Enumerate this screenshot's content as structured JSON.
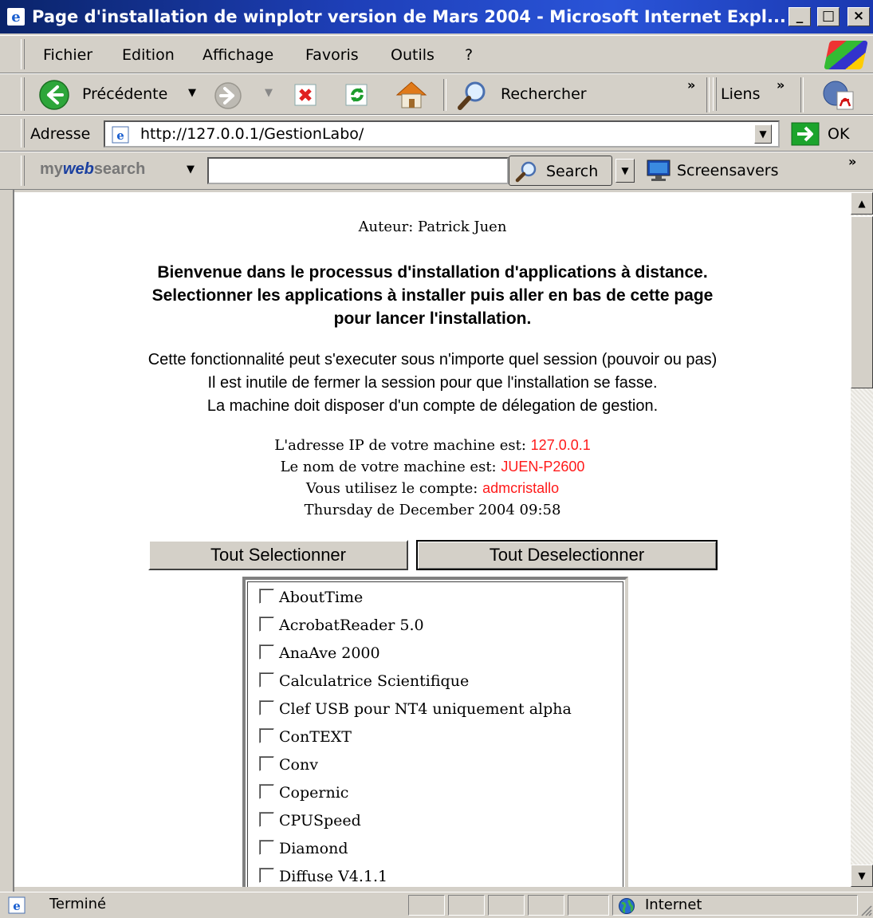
{
  "window": {
    "title": "Page d'installation de winplotr version de Mars 2004 - Microsoft Internet Expl...",
    "controls": {
      "minimize": "_",
      "maximize": "□",
      "close": "×"
    }
  },
  "menu": [
    "Fichier",
    "Edition",
    "Affichage",
    "Favoris",
    "Outils",
    "?"
  ],
  "toolbar": {
    "back_label": "Précédente",
    "search_label": "Rechercher",
    "chevron": "»",
    "links_label": "Liens"
  },
  "address": {
    "label": "Adresse",
    "url": "http://127.0.0.1/GestionLabo/",
    "go_label": "OK"
  },
  "websearch": {
    "brand_my": "my",
    "brand_web": "web",
    "brand_search": "search",
    "search_button": "Search",
    "screensavers_label": "Screensavers",
    "chevron": "»",
    "query": ""
  },
  "page": {
    "author": "Auteur: Patrick Juen",
    "welcome_lines": [
      "Bienvenue dans le processus d'installation d'applications à distance.",
      "Selectionner les applications à installer puis aller en bas de cette page",
      "pour lancer l'installation."
    ],
    "info_lines": [
      "Cette fonctionnalité peut s'executer sous n'importe quel session (pouvoir ou pas)",
      "Il est inutile de fermer la session pour que l'installation se fasse.",
      "La machine doit disposer d'un compte de délegation de gestion."
    ],
    "ip_label": "L'adresse IP de votre machine est: ",
    "ip_value": "127.0.0.1",
    "name_label": "Le nom de votre machine est: ",
    "name_value": "JUEN-P2600",
    "account_label": "Vous utilisez le compte: ",
    "account_value": "admcristallo",
    "datetime": "Thursday de December 2004 09:58",
    "select_all": "Tout Selectionner",
    "deselect_all": "Tout Deselectionner",
    "applications": [
      "AboutTime",
      "AcrobatReader 5.0",
      "AnaAve 2000",
      "Calculatrice Scientifique",
      "Clef USB pour NT4 uniquement alpha",
      "ConTEXT",
      "Conv",
      "Copernic",
      "CPUSpeed",
      "Diamond",
      "Diffuse V4.1.1"
    ]
  },
  "status": {
    "text": "Terminé",
    "zone": "Internet"
  },
  "colors": {
    "highlight_red": "#ff1a1a",
    "title_blue": "#0a246a",
    "chrome_gray": "#d4d0c8"
  }
}
